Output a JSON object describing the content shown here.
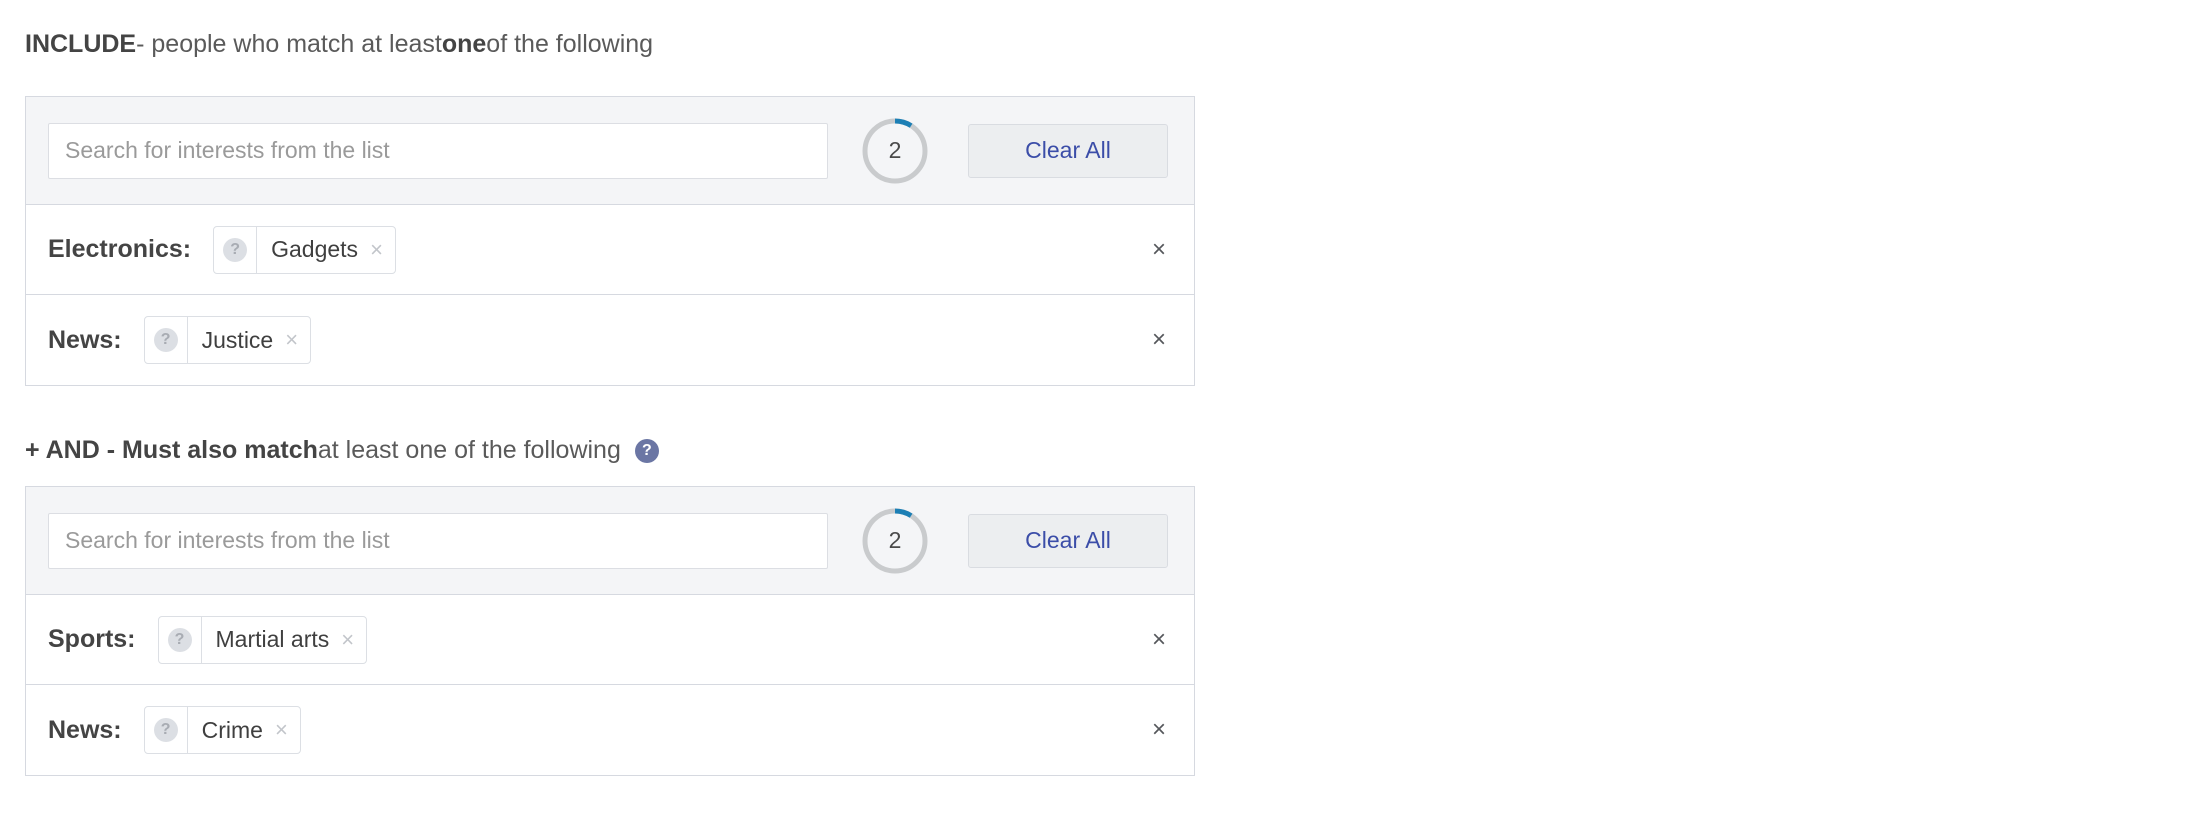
{
  "include_section": {
    "title": {
      "strong": "INCLUDE",
      "mid": " - people who match at least ",
      "emphasis": "one",
      "tail": " of the following"
    },
    "search": {
      "placeholder": "Search for interests from the list",
      "value": ""
    },
    "counter": {
      "count": "2",
      "ring_track_color": "#c9cbcd",
      "ring_progress_color": "#1c7fb5",
      "ring_progress_fraction": 0.09
    },
    "clear_all_label": "Clear All",
    "rows": [
      {
        "category": "Electronics:",
        "chip": {
          "help": "?",
          "label": "Gadgets",
          "close": "×"
        },
        "remove": "×"
      },
      {
        "category": "News:",
        "chip": {
          "help": "?",
          "label": "Justice",
          "close": "×"
        },
        "remove": "×"
      }
    ]
  },
  "and_section": {
    "title": {
      "strong": "+ AND - Must also match",
      "tail": " at least one of the following",
      "help": "?"
    },
    "search": {
      "placeholder": "Search for interests from the list",
      "value": ""
    },
    "counter": {
      "count": "2",
      "ring_track_color": "#c9cbcd",
      "ring_progress_color": "#1c7fb5",
      "ring_progress_fraction": 0.09
    },
    "clear_all_label": "Clear All",
    "rows": [
      {
        "category": "Sports:",
        "chip": {
          "help": "?",
          "label": "Martial arts",
          "close": "×"
        },
        "remove": "×"
      },
      {
        "category": "News:",
        "chip": {
          "help": "?",
          "label": "Crime",
          "close": "×"
        },
        "remove": "×"
      }
    ]
  },
  "colors": {
    "panel_border": "#d6d9e0",
    "panel_header_bg": "#f4f5f7",
    "link_blue": "#3b4da8",
    "help_badge_bg": "#6b76a4",
    "text_dark": "#444444",
    "text_muted": "#5a5a5a"
  }
}
